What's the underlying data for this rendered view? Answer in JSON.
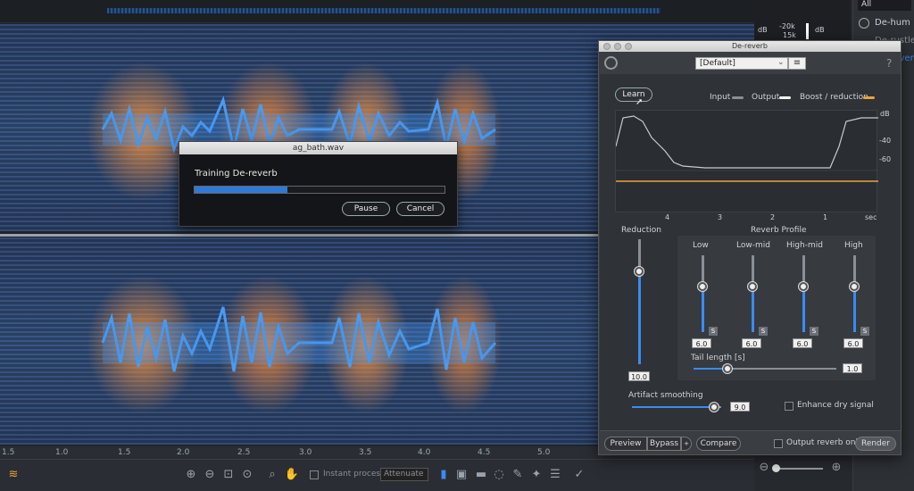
{
  "dialog": {
    "title": "ag_bath.wav",
    "message": "Training De-reverb",
    "progress": 0.37,
    "pause": "Pause",
    "cancel": "Cancel"
  },
  "panel": {
    "title": "De-reverb",
    "preset": "[Default]",
    "help": "?",
    "learn": "Learn",
    "legend": {
      "input": "Input",
      "output": "Output",
      "boost": "Boost / reduction"
    },
    "graph": {
      "db_label": "dB",
      "db_ticks": [
        "-40",
        "-60"
      ],
      "x_ticks": [
        "4",
        "3",
        "2",
        "1",
        "sec"
      ]
    },
    "reduction": {
      "label": "Reduction",
      "value": "10.0",
      "level": 0.74
    },
    "profile": {
      "label": "Reverb Profile",
      "bands": [
        {
          "name": "Low",
          "value": "6.0",
          "s": "S"
        },
        {
          "name": "Low-mid",
          "value": "6.0",
          "s": "S"
        },
        {
          "name": "High-mid",
          "value": "6.0",
          "s": "S"
        },
        {
          "name": "High",
          "value": "6.0",
          "s": "S"
        }
      ]
    },
    "tail": {
      "label": "Tail length [s]",
      "value": "1.0"
    },
    "artifact": {
      "label": "Artifact smoothing",
      "value": "9.0"
    },
    "enhance": "Enhance dry signal",
    "footer": {
      "preview": "Preview",
      "bypass": "Bypass",
      "compare": "Compare",
      "output_only": "Output reverb only",
      "render": "Render"
    }
  },
  "ruler": [
    "1.5",
    "1.0",
    "1.5",
    "2.0",
    "2.5",
    "3.0",
    "3.5",
    "4.0",
    "4.5",
    "5.0"
  ],
  "toolbar": {
    "instant_process": "Instant process",
    "mode": "Attenuate"
  },
  "meter": {
    "db": "dB",
    "scale_top": "-20k",
    "scale_2": "15k",
    "db2": "dB"
  },
  "modules": {
    "filter": "All",
    "items": [
      "De-hum",
      "De-rustle",
      "De-reverb"
    ]
  },
  "colors": {
    "accent": "#3a8cf0",
    "orange": "#e8a33b"
  }
}
